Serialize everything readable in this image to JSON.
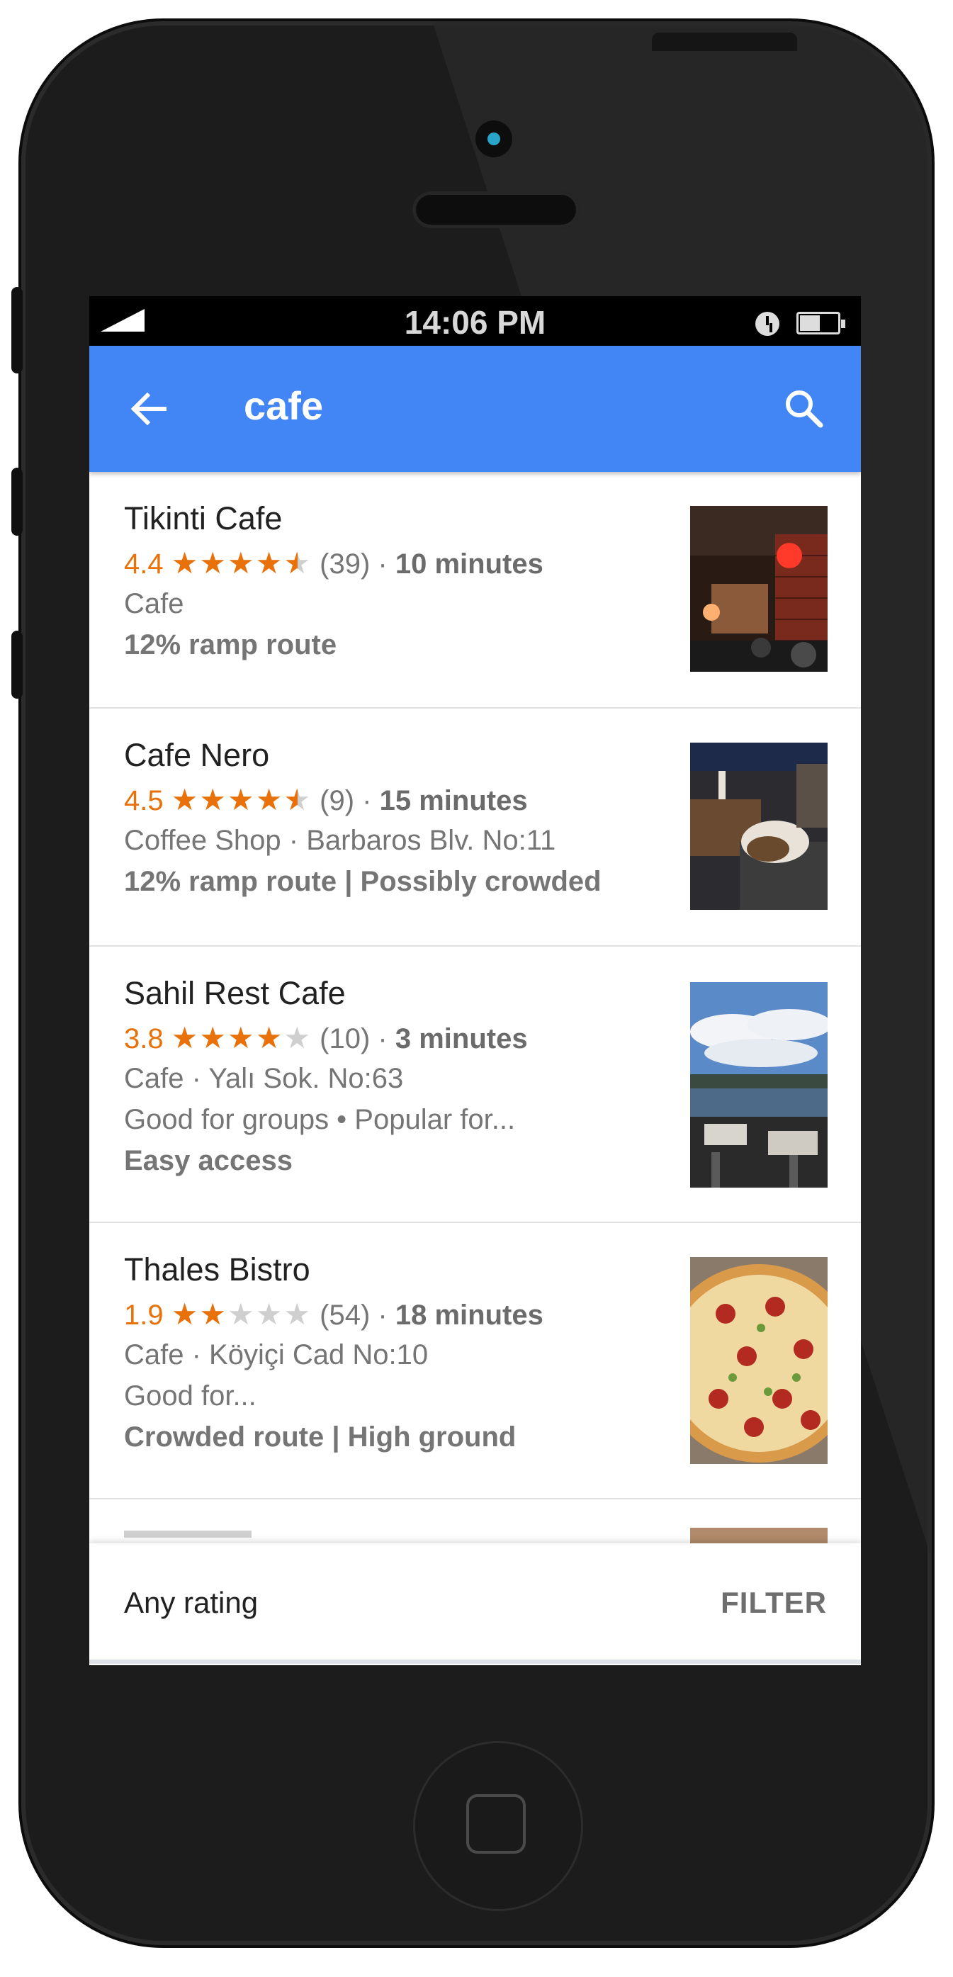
{
  "status_bar": {
    "time": "14:06 PM"
  },
  "app_bar": {
    "query": "cafe"
  },
  "results": [
    {
      "name": "Tikinti Cafe",
      "rating": "4.4",
      "stars": 4.5,
      "reviews": "(39)",
      "sep": "·",
      "minutes": "10 minutes",
      "details": "Cafe",
      "extra": "",
      "accessibility": "12% ramp route"
    },
    {
      "name": "Cafe Nero",
      "rating": "4.5",
      "stars": 4.5,
      "reviews": "(9)",
      "sep": "·",
      "minutes": "15 minutes",
      "details": "Coffee Shop · Barbaros Blv. No:11",
      "extra": "",
      "accessibility": "12% ramp route | Possibly crowded"
    },
    {
      "name": "Sahil Rest Cafe",
      "rating": "3.8",
      "stars": 4,
      "reviews": "(10)",
      "sep": "·",
      "minutes": "3 minutes",
      "details": "Cafe · Yalı Sok. No:63",
      "extra": "Good for groups • Popular for...",
      "accessibility": "Easy access"
    },
    {
      "name": "Thales Bistro",
      "rating": "1.9",
      "stars": 2,
      "reviews": "(54)",
      "sep": "·",
      "minutes": "18 minutes",
      "details": "Cafe · Köyiçi Cad No:10",
      "extra": "Good for...",
      "accessibility": "Crowded route | High ground"
    }
  ],
  "bottom_bar": {
    "rating_label": "Any rating",
    "filter_label": "FILTER"
  },
  "colors": {
    "app_bar": "#4285f4",
    "star": "#e8710a",
    "star_empty": "#cfcfcf"
  }
}
